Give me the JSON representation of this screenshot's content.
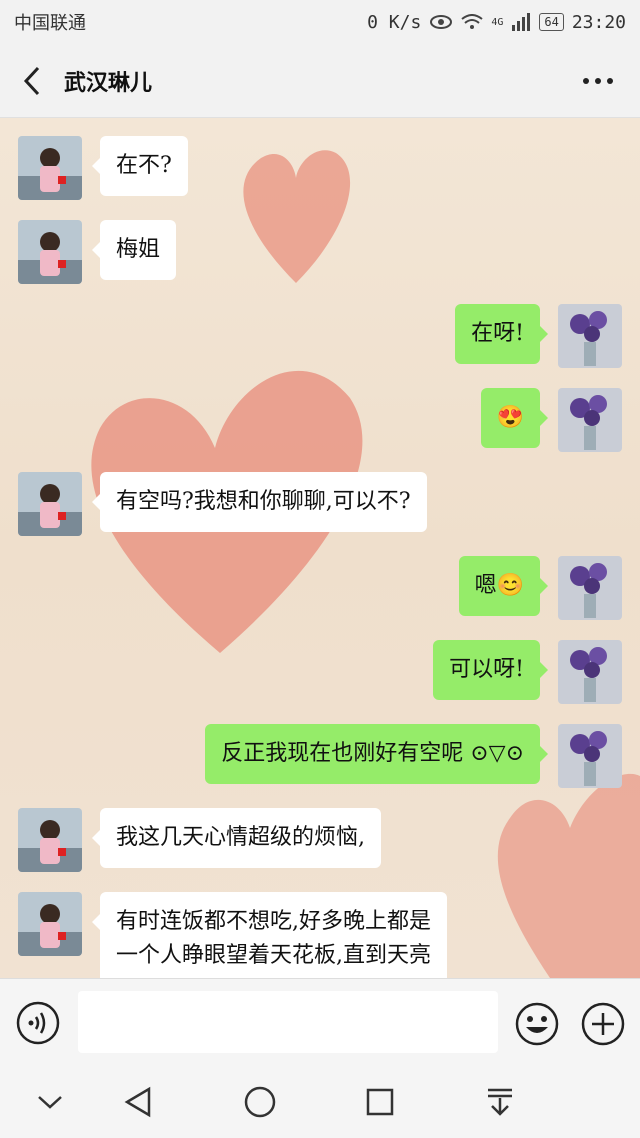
{
  "status": {
    "carrier": "中国联通",
    "speed": "0 K/s",
    "network": "4G",
    "battery": "64",
    "time": "23:20"
  },
  "header": {
    "title": "武汉琳儿"
  },
  "messages": [
    {
      "side": "in",
      "text": "在不?"
    },
    {
      "side": "in",
      "text": "梅姐"
    },
    {
      "side": "out",
      "text": "在呀!"
    },
    {
      "side": "out",
      "text": "😍"
    },
    {
      "side": "in",
      "text": "有空吗?我想和你聊聊,可以不?"
    },
    {
      "side": "out",
      "text": "嗯😊"
    },
    {
      "side": "out",
      "text": "可以呀!"
    },
    {
      "side": "out",
      "text": "反正我现在也刚好有空呢 ⊙▽⊙"
    },
    {
      "side": "in",
      "text": "我这几天心情超级的烦恼,"
    },
    {
      "side": "in",
      "text": "有时连饭都不想吃,好多晚上都是",
      "text2": "一个人睁眼望着天花板,直到天亮"
    }
  ],
  "icons": {
    "back": "chevron-left-icon",
    "more": "more-dots-icon",
    "voice": "voice-icon",
    "emoji": "emoji-icon",
    "plus": "plus-icon"
  },
  "colors": {
    "out_bubble": "#95ec69",
    "in_bubble": "#ffffff",
    "heart": "#e8917f"
  }
}
